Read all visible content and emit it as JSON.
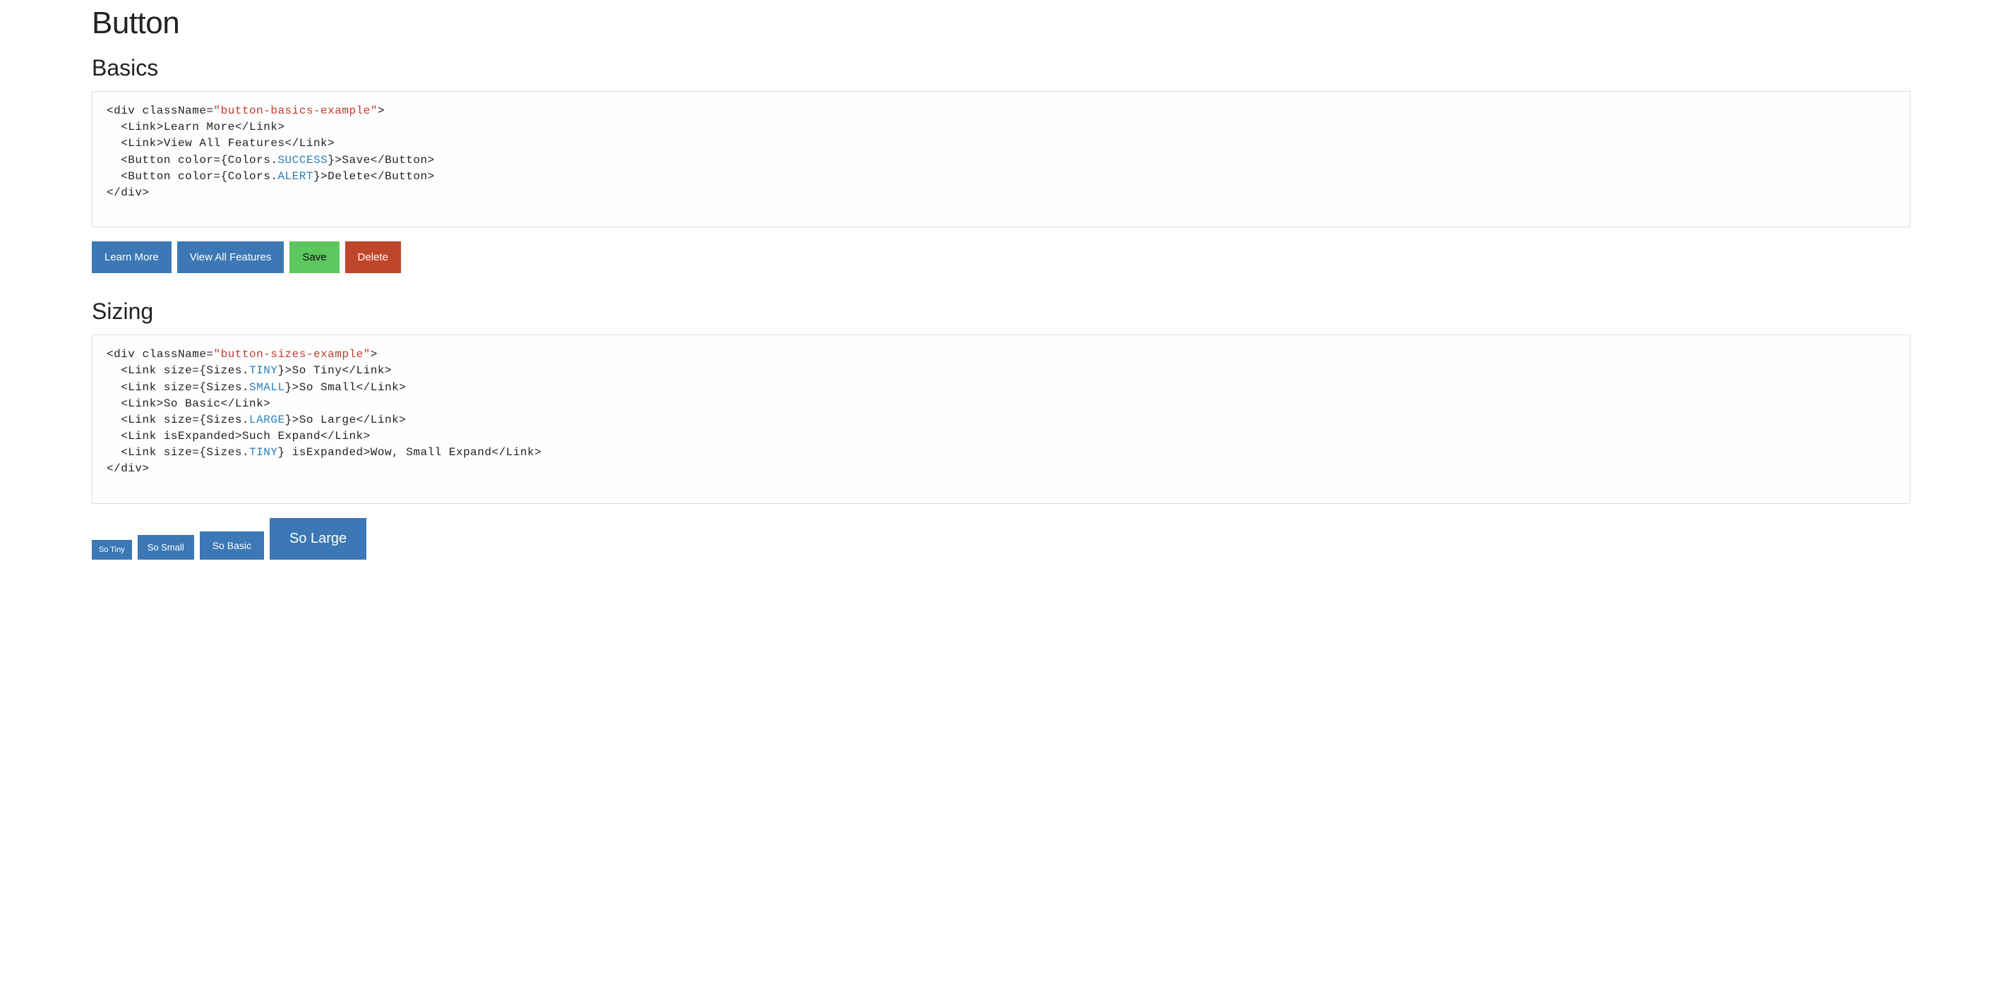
{
  "page": {
    "title": "Button"
  },
  "sections": {
    "basics": {
      "heading": "Basics",
      "code": {
        "line1_pre": "<div className=",
        "line1_str": "\"button-basics-example\"",
        "line1_post": ">",
        "line2": "  <Link>Learn More</Link>",
        "line3": "  <Link>View All Features</Link>",
        "line4_pre": "  <Button color={Colors.",
        "line4_attr": "SUCCESS",
        "line4_post": "}>Save</Button>",
        "line5_pre": "  <Button color={Colors.",
        "line5_attr": "ALERT",
        "line5_post": "}>Delete</Button>",
        "line6": "</div>"
      },
      "buttons": {
        "learn_more": "Learn More",
        "view_all": "View All Features",
        "save": "Save",
        "delete": "Delete"
      }
    },
    "sizing": {
      "heading": "Sizing",
      "code": {
        "line1_pre": "<div className=",
        "line1_str": "\"button-sizes-example\"",
        "line1_post": ">",
        "line2_pre": "  <Link size={Sizes.",
        "line2_attr": "TINY",
        "line2_post": "}>So Tiny</Link>",
        "line3_pre": "  <Link size={Sizes.",
        "line3_attr": "SMALL",
        "line3_post": "}>So Small</Link>",
        "line4": "  <Link>So Basic</Link>",
        "line5_pre": "  <Link size={Sizes.",
        "line5_attr": "LARGE",
        "line5_post": "}>So Large</Link>",
        "line6": "  <Link isExpanded>Such Expand</Link>",
        "line7_pre": "  <Link size={Sizes.",
        "line7_attr": "TINY",
        "line7_post": "} isExpanded>Wow, Small Expand</Link>",
        "line8": "</div>"
      },
      "buttons": {
        "tiny": "So Tiny",
        "small": "So Small",
        "basic": "So Basic",
        "large": "So Large"
      }
    }
  }
}
